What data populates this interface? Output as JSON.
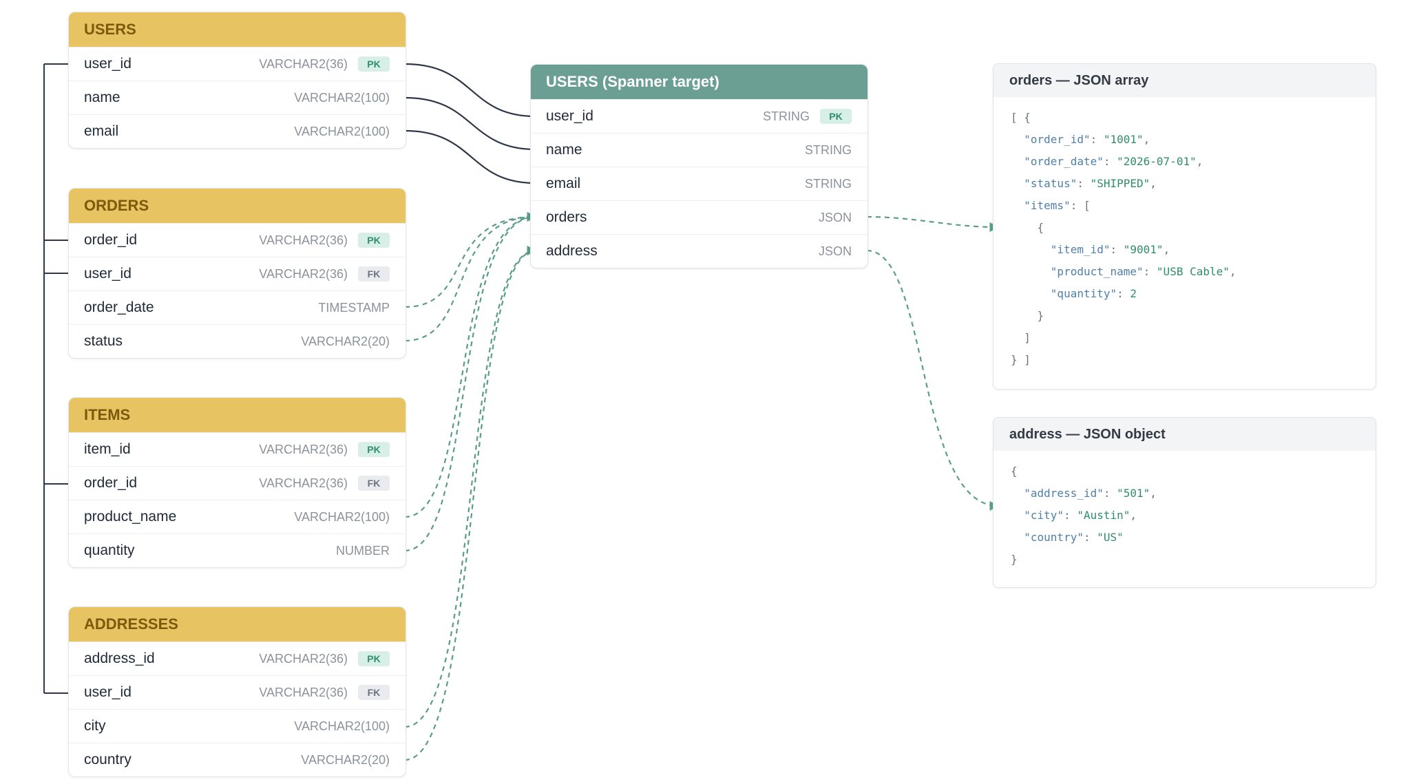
{
  "source_tables": [
    {
      "name": "USERS",
      "rows": [
        {
          "name": "user_id",
          "type": "VARCHAR2(36)",
          "badge": "PK"
        },
        {
          "name": "name",
          "type": "VARCHAR2(100)"
        },
        {
          "name": "email",
          "type": "VARCHAR2(100)"
        }
      ]
    },
    {
      "name": "ORDERS",
      "rows": [
        {
          "name": "order_id",
          "type": "VARCHAR2(36)",
          "badge": "PK"
        },
        {
          "name": "user_id",
          "type": "VARCHAR2(36)",
          "badge": "FK"
        },
        {
          "name": "order_date",
          "type": "TIMESTAMP"
        },
        {
          "name": "status",
          "type": "VARCHAR2(20)"
        }
      ]
    },
    {
      "name": "ITEMS",
      "rows": [
        {
          "name": "item_id",
          "type": "VARCHAR2(36)",
          "badge": "PK"
        },
        {
          "name": "order_id",
          "type": "VARCHAR2(36)",
          "badge": "FK"
        },
        {
          "name": "product_name",
          "type": "VARCHAR2(100)"
        },
        {
          "name": "quantity",
          "type": "NUMBER"
        }
      ]
    },
    {
      "name": "ADDRESSES",
      "rows": [
        {
          "name": "address_id",
          "type": "VARCHAR2(36)",
          "badge": "PK"
        },
        {
          "name": "user_id",
          "type": "VARCHAR2(36)",
          "badge": "FK"
        },
        {
          "name": "city",
          "type": "VARCHAR2(100)"
        },
        {
          "name": "country",
          "type": "VARCHAR2(20)"
        }
      ]
    }
  ],
  "target_table": {
    "name": "USERS  (Spanner target)",
    "rows": [
      {
        "name": "user_id",
        "type": "STRING",
        "badge": "PK"
      },
      {
        "name": "name",
        "type": "STRING"
      },
      {
        "name": "email",
        "type": "STRING"
      },
      {
        "name": "orders",
        "type": "JSON"
      },
      {
        "name": "address",
        "type": "JSON"
      }
    ]
  },
  "orders_panel": {
    "title": "orders — JSON array",
    "code": [
      "[ {",
      "  \"order_id\": \"1001\",",
      "  \"order_date\": \"2026-07-01\",",
      "  \"status\": \"SHIPPED\",",
      "  \"items\": [",
      "    {",
      "      \"item_id\": \"9001\",",
      "      \"product_name\": \"USB Cable\",",
      "      \"quantity\": 2",
      "    }",
      "  ]",
      "} ]"
    ]
  },
  "address_panel": {
    "title": "address — JSON object",
    "code": [
      "{",
      "  \"address_id\": \"501\",",
      "  \"city\": \"Austin\",",
      "  \"country\": \"US\"",
      "}"
    ]
  },
  "colors": {
    "source_header": "#e8c362",
    "target_header": "#6b9f94",
    "solid_link": "#2d3748",
    "dashed_link": "#5a9c8a",
    "pk_badge": "#d7efe6",
    "fk_badge": "#e9ebee"
  }
}
